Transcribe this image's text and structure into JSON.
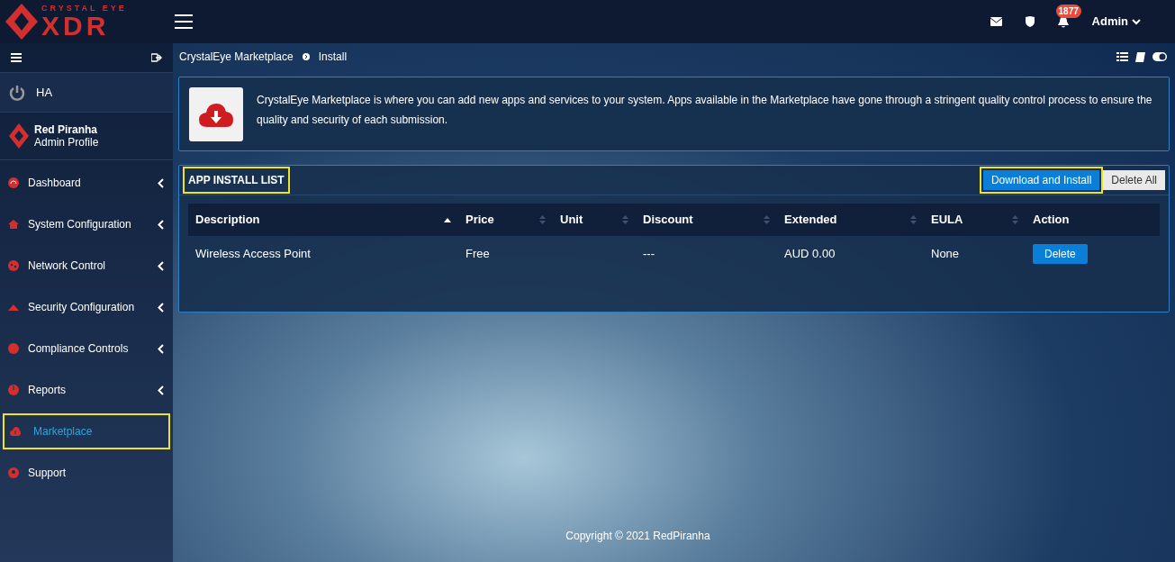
{
  "logo": {
    "top": "CRYSTAL EYE",
    "main": "XDR"
  },
  "topbar": {
    "notification_count": "1877",
    "user": "Admin"
  },
  "sidebar": {
    "ha": "HA",
    "profile": {
      "name": "Red Piranha",
      "role": "Admin Profile"
    },
    "items": [
      {
        "label": "Dashboard",
        "expandable": true,
        "selected": false,
        "highlighted": false
      },
      {
        "label": "System Configuration",
        "expandable": true,
        "selected": false,
        "highlighted": false
      },
      {
        "label": "Network Control",
        "expandable": true,
        "selected": false,
        "highlighted": false
      },
      {
        "label": "Security Configuration",
        "expandable": true,
        "selected": false,
        "highlighted": false
      },
      {
        "label": "Compliance Controls",
        "expandable": true,
        "selected": false,
        "highlighted": false
      },
      {
        "label": "Reports",
        "expandable": true,
        "selected": false,
        "highlighted": false
      },
      {
        "label": "Marketplace",
        "expandable": false,
        "selected": true,
        "highlighted": true
      },
      {
        "label": "Support",
        "expandable": false,
        "selected": false,
        "highlighted": false
      }
    ]
  },
  "breadcrumb": [
    "CrystalEye Marketplace",
    "Install"
  ],
  "info": "CrystalEye Marketplace is where you can add new apps and services to your system. Apps available in the Marketplace have gone through a stringent quality control process to ensure the quality and security of each submission.",
  "panel": {
    "title": "APP INSTALL LIST",
    "title_highlighted": true,
    "buttons": [
      {
        "label": "Download and Install",
        "kind": "primary",
        "highlighted": true
      },
      {
        "label": "Delete All",
        "kind": "secondary",
        "highlighted": false
      }
    ],
    "columns": [
      {
        "label": "Description",
        "sortable": true,
        "sorted": true
      },
      {
        "label": "Price",
        "sortable": true,
        "sorted": false
      },
      {
        "label": "Unit",
        "sortable": true,
        "sorted": false
      },
      {
        "label": "Discount",
        "sortable": true,
        "sorted": false
      },
      {
        "label": "Extended",
        "sortable": true,
        "sorted": false
      },
      {
        "label": "EULA",
        "sortable": true,
        "sorted": false
      },
      {
        "label": "Action",
        "sortable": false,
        "sorted": false
      }
    ],
    "rows": [
      {
        "cells": [
          "Wireless Access Point",
          "Free",
          "",
          "---",
          "AUD 0.00",
          "None"
        ],
        "action": "Delete"
      }
    ]
  },
  "footer": "Copyright © 2021 RedPiranha"
}
